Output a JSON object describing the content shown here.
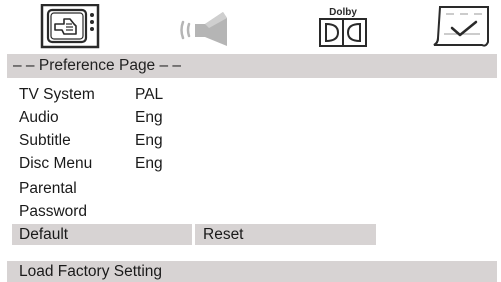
{
  "tabs": [
    {
      "icon": "general-setup-icon"
    },
    {
      "icon": "speaker-audio-icon"
    },
    {
      "icon": "dolby-digital-icon",
      "label": "Dolby"
    },
    {
      "icon": "preference-check-icon"
    }
  ],
  "page_title": "– – Preference Page – –",
  "menu": [
    {
      "label": "TV System",
      "value": "PAL"
    },
    {
      "label": "Audio",
      "value": "Eng"
    },
    {
      "label": "Subtitle",
      "value": "Eng"
    },
    {
      "label": "Disc Menu",
      "value": "Eng"
    },
    {
      "label": "Parental",
      "value": ""
    },
    {
      "label": "Password",
      "value": ""
    },
    {
      "label": "Default",
      "value": "",
      "option": "Reset"
    }
  ],
  "status": "Load Factory Setting",
  "colors": {
    "highlight": "#d7d3d3",
    "icon_stroke": "#2a2a2a",
    "speaker_gray": "#b5b5b5"
  }
}
